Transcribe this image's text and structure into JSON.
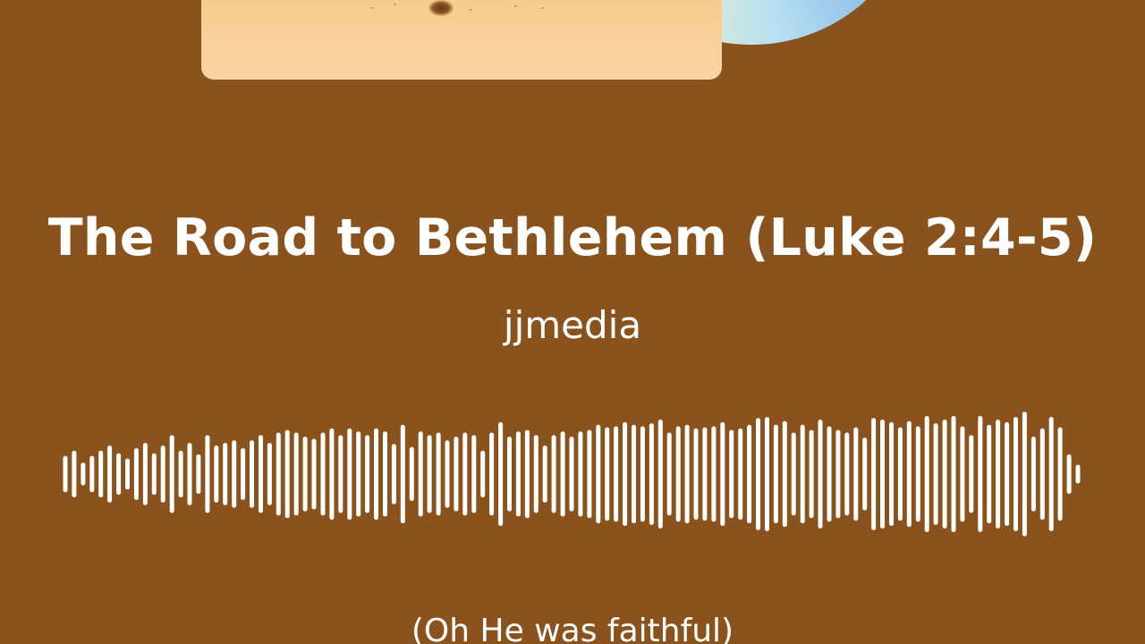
{
  "track": {
    "title": "The Road to Bethlehem (Luke 2:4-5)",
    "artist": "jjmedia"
  },
  "lyrics": {
    "current_line": "(Oh He was faithful)"
  },
  "waveform": {
    "levels": [
      0.35,
      0.45,
      0.22,
      0.35,
      0.45,
      0.55,
      0.4,
      0.3,
      0.5,
      0.6,
      0.4,
      0.55,
      0.75,
      0.45,
      0.6,
      0.38,
      0.75,
      0.55,
      0.6,
      0.65,
      0.5,
      0.65,
      0.75,
      0.6,
      0.8,
      0.85,
      0.8,
      0.72,
      0.68,
      0.8,
      0.88,
      0.75,
      0.88,
      0.82,
      0.75,
      0.88,
      0.82,
      0.58,
      0.95,
      0.52,
      0.82,
      0.75,
      0.8,
      0.65,
      0.72,
      0.8,
      0.75,
      0.45,
      0.8,
      1.0,
      0.72,
      0.82,
      0.85,
      0.75,
      0.55,
      0.75,
      0.82,
      0.72,
      0.82,
      0.85,
      0.95,
      0.9,
      0.92,
      1.0,
      0.95,
      0.92,
      0.98,
      1.05,
      0.8,
      0.92,
      0.95,
      0.88,
      0.9,
      0.92,
      1.0,
      0.85,
      0.88,
      0.95,
      1.08,
      1.1,
      0.95,
      1.02,
      0.8,
      0.95,
      0.85,
      1.05,
      0.92,
      0.85,
      0.8,
      0.9,
      0.7,
      1.08,
      1.05,
      1.0,
      0.9,
      1.02,
      0.92,
      1.12,
      0.98,
      1.05,
      1.12,
      0.92,
      0.75,
      1.12,
      0.95,
      1.05,
      1.0,
      1.1,
      1.2,
      0.72,
      0.88,
      1.1,
      0.9,
      0.38,
      0.18
    ]
  },
  "colors": {
    "background": "#8a521c",
    "foreground": "#ffffff",
    "cover": "#f8d09a"
  }
}
